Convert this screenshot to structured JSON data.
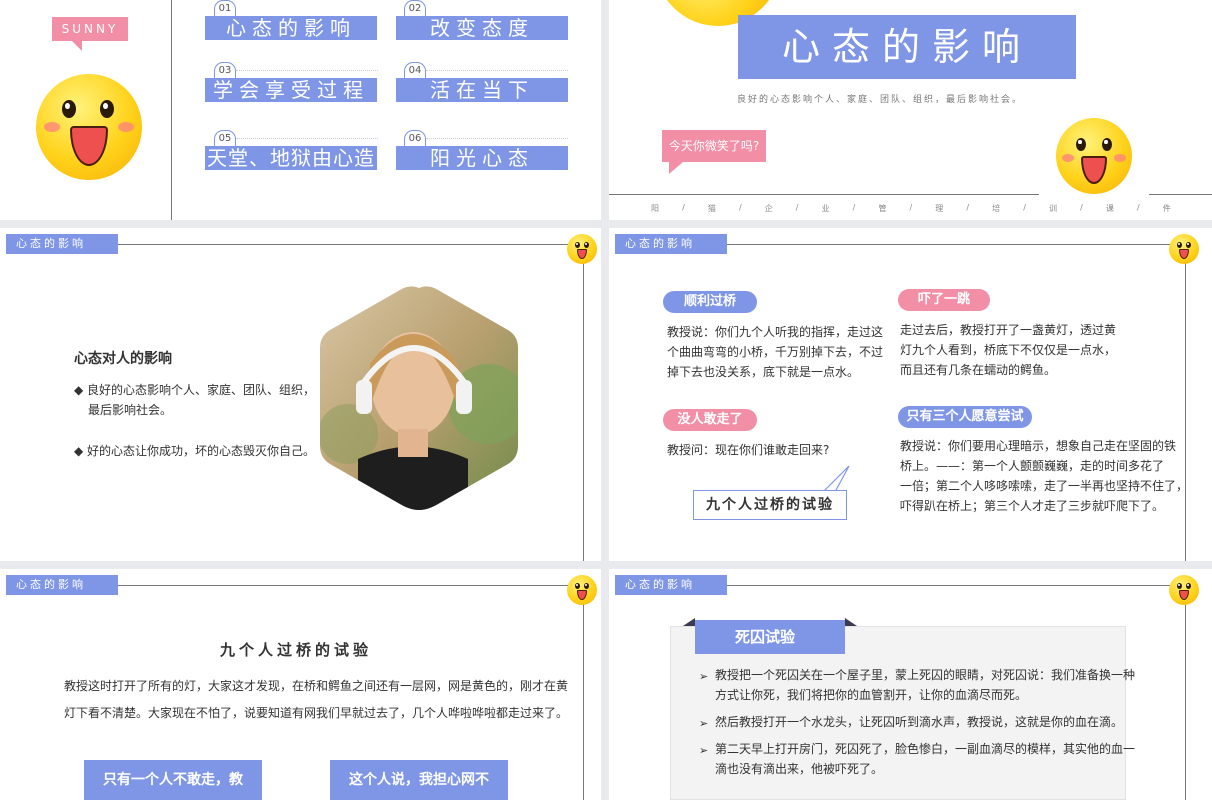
{
  "slide1": {
    "sunny": "SUNNY",
    "items": [
      {
        "num": "01",
        "label": "心态的影响"
      },
      {
        "num": "02",
        "label": "改变态度"
      },
      {
        "num": "03",
        "label": "学会享受过程"
      },
      {
        "num": "04",
        "label": "活在当下"
      },
      {
        "num": "05",
        "label": "天堂、地狱由心造"
      },
      {
        "num": "06",
        "label": "阳光心态"
      }
    ]
  },
  "slide2": {
    "title": "心态的影响",
    "subtitle": "良好的心态影响个人、家庭、团队、组织，最后影响社会。",
    "bubble": "今天你微笑了吗?",
    "footer_chars": [
      "阳",
      "/",
      "猫",
      "/",
      "企",
      "/",
      "业",
      "/",
      "管",
      "/",
      "理",
      "/",
      "培",
      "/",
      "训",
      "/",
      "课",
      "/",
      "件"
    ]
  },
  "header_tag": "心态的影响",
  "slide3": {
    "heading": "心态对人的影响",
    "bullet1": "◆ 良好的心态影响个人、家庭、团队、组织，",
    "bullet1b": "最后影响社会。",
    "bullet2": "◆ 好的心态让你成功，坏的心态毁灭你自己。"
  },
  "slide4": {
    "p1_title": "顺利过桥",
    "p1_lines": [
      "教授说：你们九个人听我的指挥，走过这",
      "个曲曲弯弯的小桥，千万别掉下去，不过",
      "掉下去也没关系，底下就是一点水。"
    ],
    "p2_title": "吓了一跳",
    "p2_lines": [
      "走过去后，教授打开了一盏黄灯，透过黄",
      "灯九个人看到，桥底下不仅仅是一点水，",
      "而且还有几条在蠕动的鳄鱼。"
    ],
    "p3_title": "没人敢走了",
    "p3_lines": [
      "教授问：现在你们谁敢走回来?"
    ],
    "p4_title": "只有三个人愿意尝试",
    "p4_lines": [
      "教授说：你们要用心理暗示，想象自己走在坚固的铁",
      "桥上。——：第一个人颤颤巍巍，走的时间多花了",
      "一倍；第二个人哆哆嗦嗦，走了一半再也坚持不住了，",
      "吓得趴在桥上；第三个人才走了三步就吓爬下了。"
    ],
    "callout": "九个人过桥的试验"
  },
  "slide5": {
    "title": "九个人过桥的试验",
    "lines": [
      "教授这时打开了所有的灯，大家这才发现，在桥和鳄鱼之间还有一层网，网是黄色的，刚才在黄",
      "灯下看不清楚。大家现在不怕了，说要知道有网我们早就过去了，几个人哗啦哗啦都走过来了。"
    ],
    "box1": "只有一个人不敢走，教",
    "box2": "这个人说，我担心网不"
  },
  "slide6": {
    "title": "死囚试验",
    "b1": [
      "教授把一个死囚关在一个屋子里，蒙上死囚的眼睛，对死囚说：我们准备换一种",
      "方式让你死，我们将把你的血管割开，让你的血滴尽而死。"
    ],
    "b2": [
      "然后教授打开一个水龙头，让死囚听到滴水声，教授说，这就是你的血在滴。"
    ],
    "b3": [
      "第二天早上打开房门，死囚死了，脸色惨白，一副血滴尽的模样，其实他的血一",
      "滴也没有滴出来，他被吓死了。"
    ]
  },
  "colors": {
    "blue": "#7f96e6",
    "pink": "#f28ea6"
  }
}
